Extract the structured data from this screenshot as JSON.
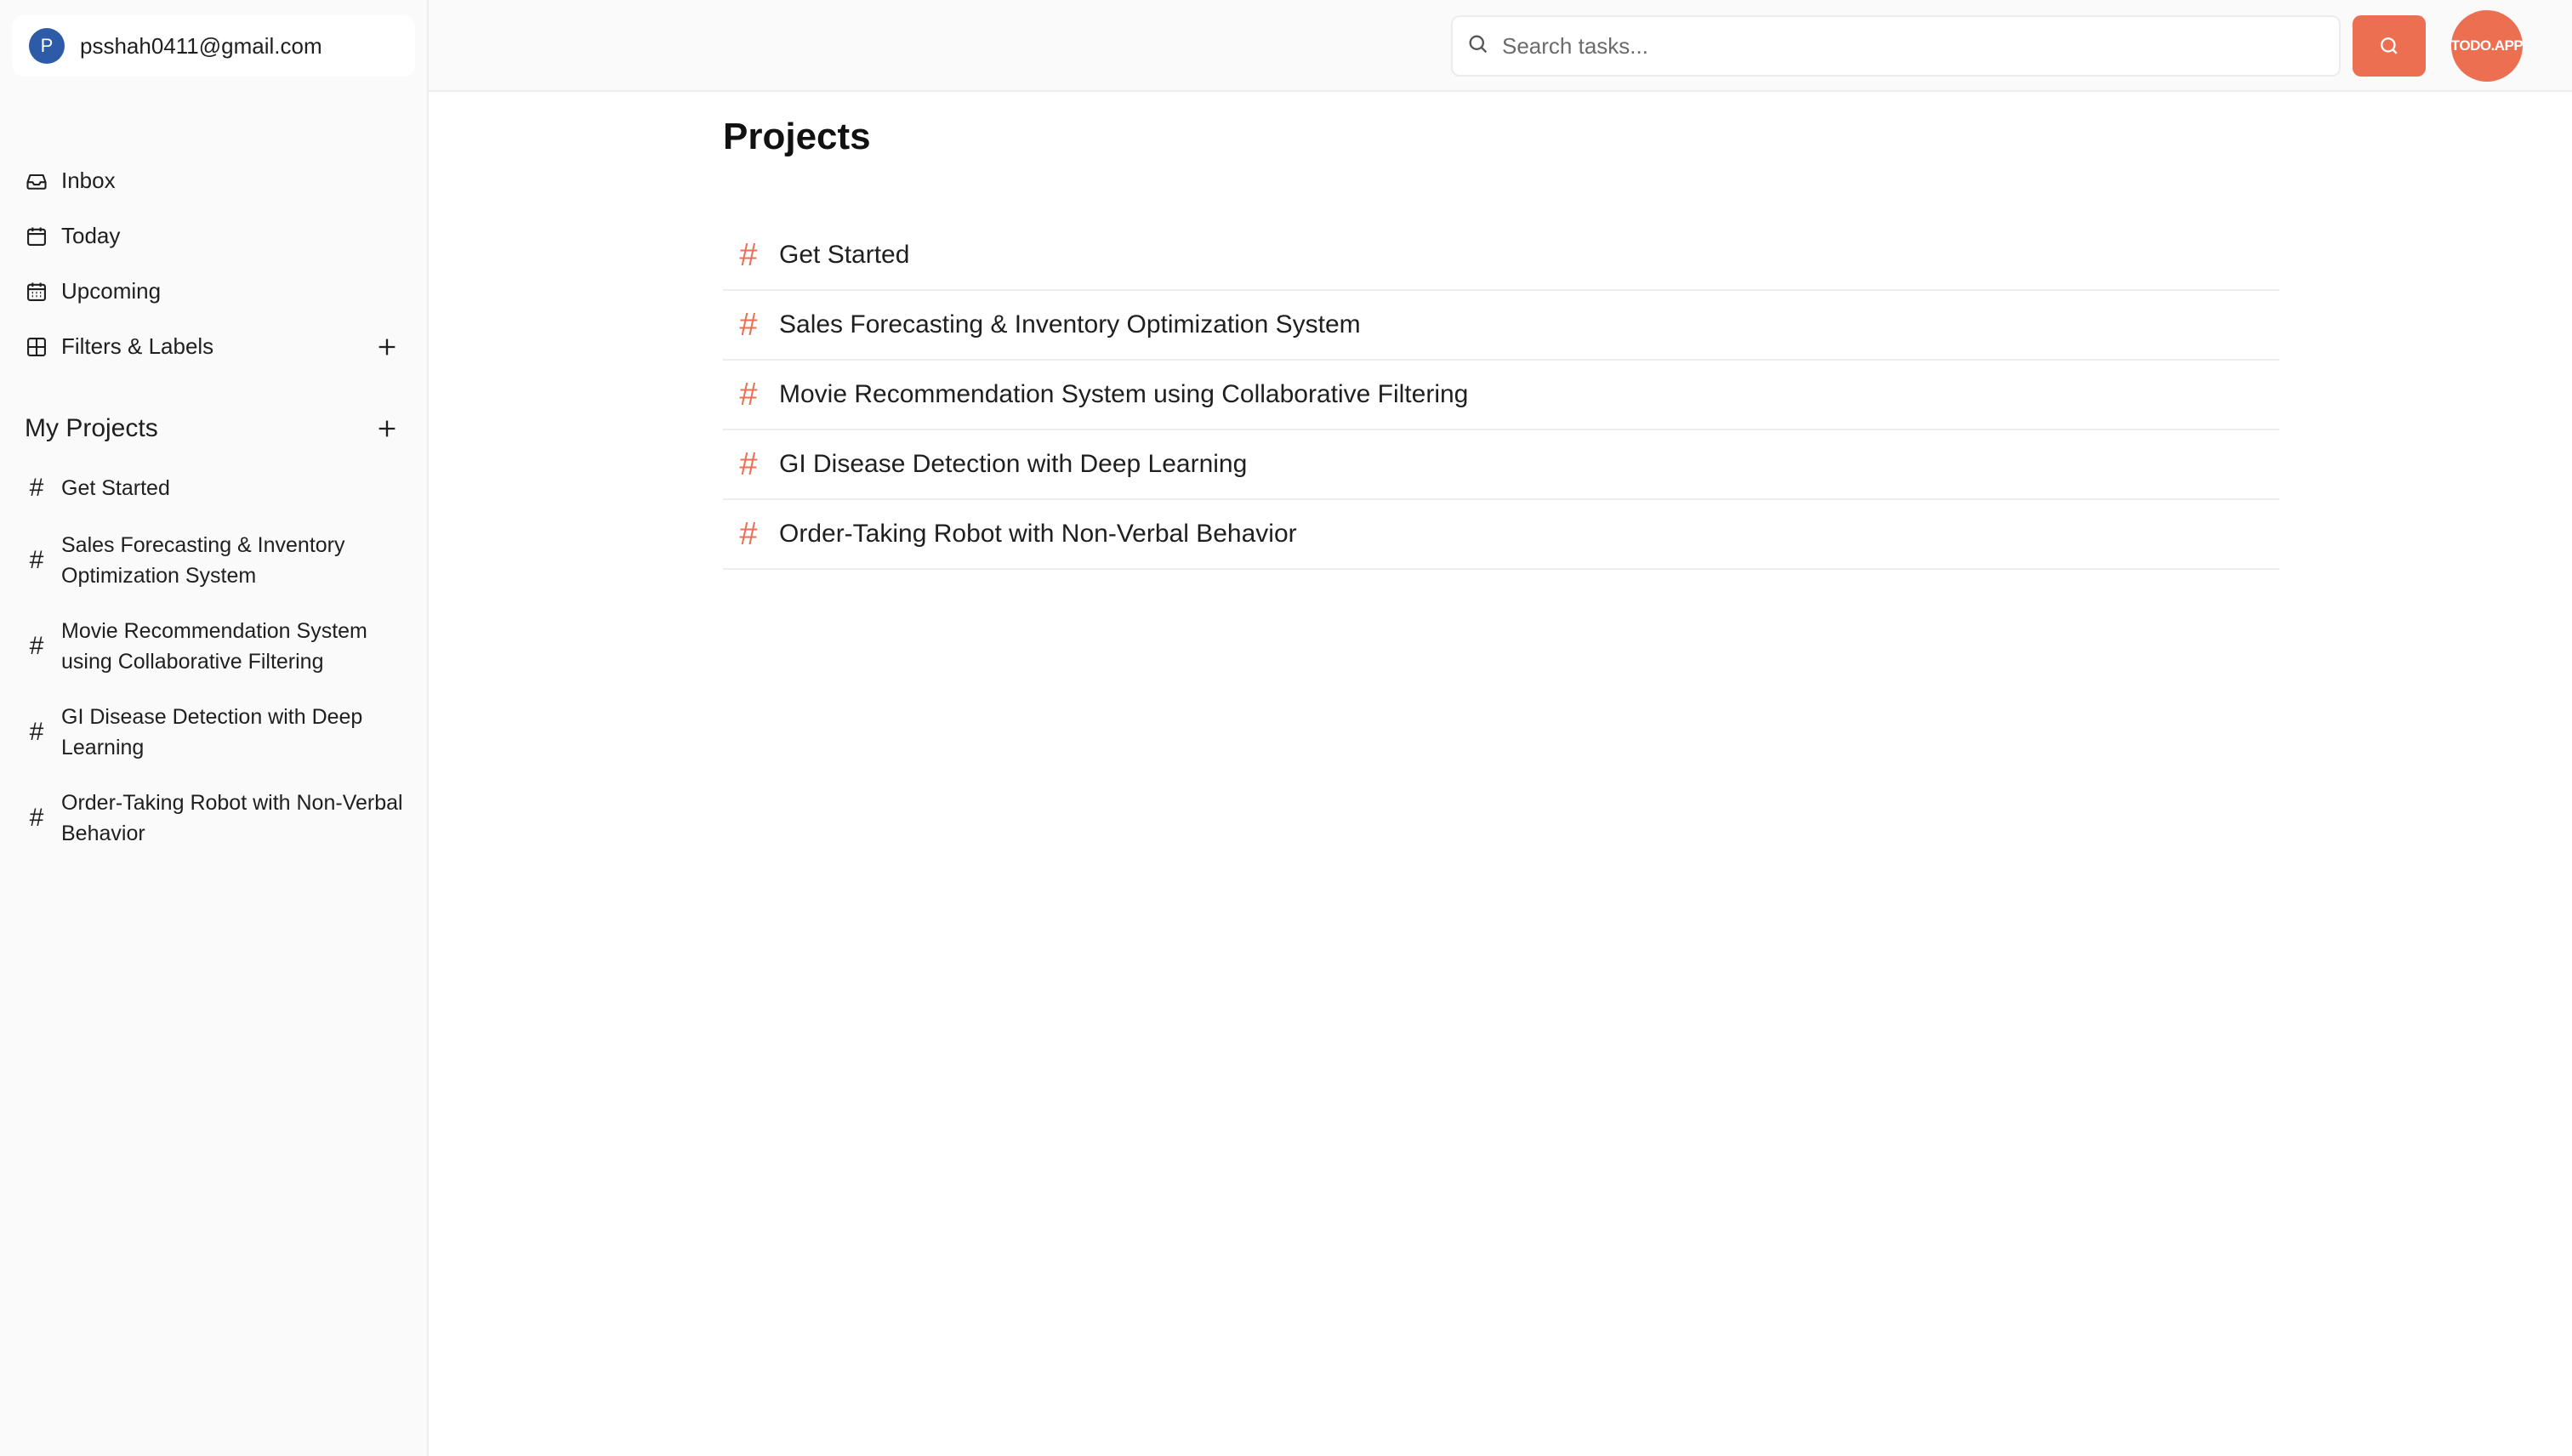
{
  "user": {
    "avatar_letter": "P",
    "email": "psshah0411@gmail.com"
  },
  "sidebar": {
    "nav": [
      {
        "label": "Inbox",
        "icon": "inbox-icon"
      },
      {
        "label": "Today",
        "icon": "calendar-icon"
      },
      {
        "label": "Upcoming",
        "icon": "calendar-grid-icon"
      },
      {
        "label": "Filters & Labels",
        "icon": "grid-icon"
      }
    ],
    "projects_title": "My Projects",
    "projects": [
      {
        "label": "Get Started"
      },
      {
        "label": "Sales Forecasting & Inventory Optimization System"
      },
      {
        "label": "Movie Recommendation System using Collaborative Filtering"
      },
      {
        "label": "GI Disease Detection with Deep Learning"
      },
      {
        "label": "Order-Taking Robot with Non-Verbal Behavior"
      }
    ]
  },
  "header": {
    "search_placeholder": "Search tasks...",
    "logo_text": "TODO.APP"
  },
  "main": {
    "title": "Projects",
    "projects": [
      {
        "label": "Get Started"
      },
      {
        "label": "Sales Forecasting & Inventory Optimization System"
      },
      {
        "label": "Movie Recommendation System using Collaborative Filtering"
      },
      {
        "label": "GI Disease Detection with Deep Learning"
      },
      {
        "label": "Order-Taking Robot with Non-Verbal Behavior"
      }
    ]
  },
  "colors": {
    "accent": "#ec6f52",
    "avatar": "#2d5ba8",
    "sidebar_bg": "#fafafa"
  }
}
